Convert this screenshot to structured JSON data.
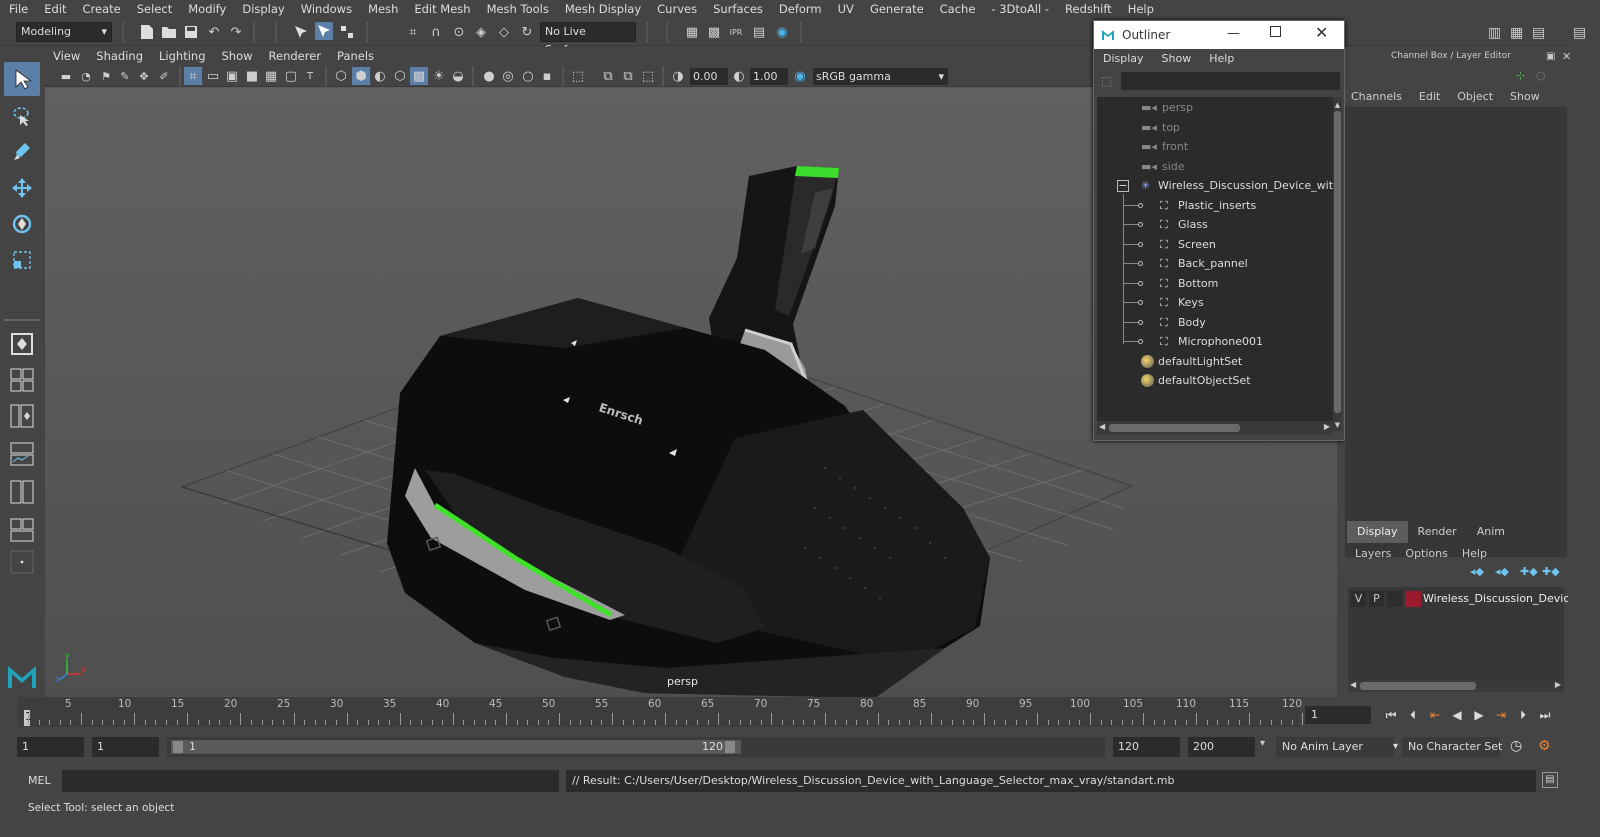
{
  "menubar": {
    "items": [
      "File",
      "Edit",
      "Create",
      "Select",
      "Modify",
      "Display",
      "Windows",
      "Mesh",
      "Edit Mesh",
      "Mesh Tools",
      "Mesh Display",
      "Curves",
      "Surfaces",
      "Deform",
      "UV",
      "Generate",
      "Cache",
      "- 3DtoAll -",
      "Redshift",
      "Help"
    ]
  },
  "statusline": {
    "mode": "Modeling",
    "live_surface": "No Live Surface"
  },
  "viewport": {
    "menu": [
      "View",
      "Shading",
      "Lighting",
      "Show",
      "Renderer",
      "Panels"
    ],
    "exposure": "0.00",
    "gamma": "1.00",
    "colorspace": "sRGB gamma",
    "camera_label": "persp",
    "logo_text": "Enrsch"
  },
  "outliner": {
    "title": "Outliner",
    "menu": [
      "Display",
      "Show",
      "Help"
    ],
    "cameras": [
      "persp",
      "top",
      "front",
      "side"
    ],
    "group": "Wireless_Discussion_Device_with_",
    "children": [
      "Plastic_inserts",
      "Glass",
      "Screen",
      "Back_pannel",
      "Bottom",
      "Keys",
      "Body",
      "Microphone001"
    ],
    "sets": [
      "defaultLightSet",
      "defaultObjectSet"
    ]
  },
  "channelbox": {
    "title": "Channel Box / Layer Editor",
    "menu": [
      "Channels",
      "Edit",
      "Object",
      "Show"
    ],
    "tabs": [
      "Display",
      "Render",
      "Anim"
    ],
    "layer_menu": [
      "Layers",
      "Options",
      "Help"
    ],
    "layer": {
      "v": "V",
      "p": "P",
      "name": "Wireless_Discussion_Device",
      "color": "#9b1a2e"
    }
  },
  "timeslider": {
    "labels": [
      "5",
      "10",
      "15",
      "20",
      "25",
      "30",
      "35",
      "40",
      "45",
      "50",
      "55",
      "60",
      "65",
      "70",
      "75",
      "80",
      "85",
      "90",
      "95",
      "100",
      "105",
      "110",
      "115",
      "120"
    ],
    "current_marker": "1",
    "current_frame": "1"
  },
  "rangebar": {
    "start": "1",
    "playback_start": "1",
    "range_start": "1",
    "range_end": "120",
    "playback_end": "120",
    "end": "200",
    "anim_layer": "No Anim Layer",
    "char_set": "No Character Set"
  },
  "cmdline": {
    "mode": "MEL",
    "result": "// Result: C:/Users/User/Desktop/Wireless_Discussion_Device_with_Language_Selector_max_vray/standart.mb"
  },
  "helpline": {
    "text": "Select Tool: select an object"
  }
}
